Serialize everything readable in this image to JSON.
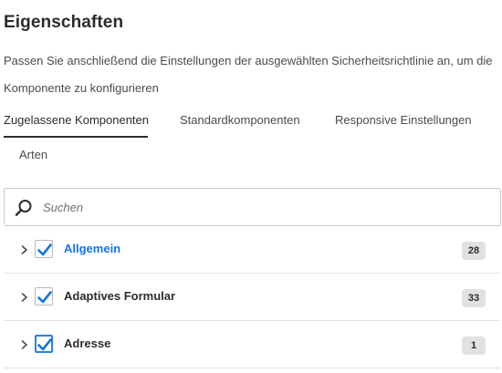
{
  "panel": {
    "title": "Eigenschaften",
    "description": "Passen Sie anschließend die Einstellungen der ausgewählten Sicherheitsrichtlinie an, um die Komponente zu konfigurieren"
  },
  "tabs": [
    {
      "label": "Zugelassene Komponenten",
      "selected": true
    },
    {
      "label": "Standardkomponenten",
      "selected": false
    },
    {
      "label": "Responsive Einstellungen",
      "selected": false
    },
    {
      "label": "Arten",
      "selected": false
    }
  ],
  "search": {
    "placeholder": "Suchen",
    "value": "",
    "icon": "search-icon"
  },
  "components": [
    {
      "label": "Allgemein",
      "count": "28",
      "checked": true,
      "highlighted": true
    },
    {
      "label": "Adaptives Formular",
      "count": "33",
      "checked": true,
      "highlighted": false
    },
    {
      "label": "Adresse",
      "count": "1",
      "checked": true,
      "highlighted": false,
      "focused": true
    }
  ],
  "colors": {
    "accent": "#1473e6",
    "check": "#1473e6",
    "focus": "#2680eb",
    "badge_bg": "#e1e1e1"
  }
}
